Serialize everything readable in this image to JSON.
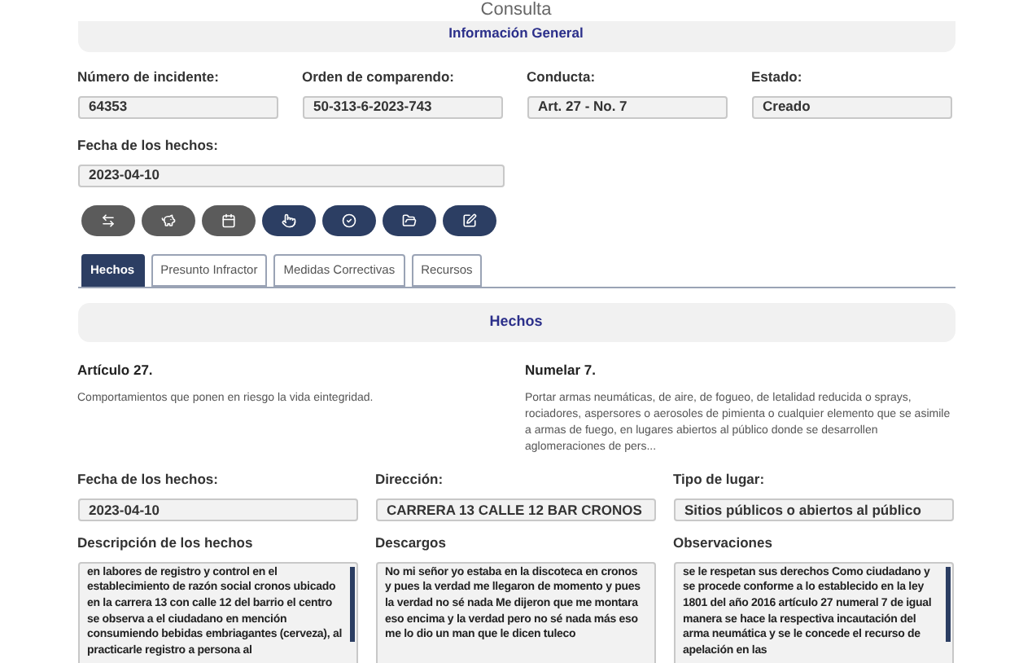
{
  "page_title": "Consulta",
  "general_header": "Información General",
  "fields": [
    {
      "label": "Número de incidente:",
      "value": "64353"
    },
    {
      "label": "Orden de comparendo:",
      "value": "50-313-6-2023-743"
    },
    {
      "label": "Conducta:",
      "value": "Art. 27 - No. 7"
    },
    {
      "label": "Estado:",
      "value": "Creado"
    }
  ],
  "date_field": {
    "label": "Fecha de los hechos:",
    "value": "2023-04-10"
  },
  "action_buttons": [
    {
      "kind": "swap"
    },
    {
      "kind": "piggy"
    },
    {
      "kind": "calendar"
    },
    {
      "kind": "hand"
    },
    {
      "kind": "check"
    },
    {
      "kind": "folder"
    },
    {
      "kind": "note"
    }
  ],
  "tabs": [
    {
      "label": "Hechos",
      "selected": true
    },
    {
      "label": "Presunto Infractor",
      "selected": false
    },
    {
      "label": "Medidas Correctivas",
      "selected": false
    },
    {
      "label": "Recursos",
      "selected": false
    }
  ],
  "section_header": "Hechos",
  "article": {
    "title": "Artículo 27.",
    "text": "Comportamientos que ponen en riesgo la vida eintegridad."
  },
  "numeral": {
    "title": "Numelar 7.",
    "text": "Portar armas neumáticas, de aire, de fogueo, de letalidad reducida o sprays, rociadores, aspersores o aerosoles de pimienta o cualquier elemento que se asimile a armas de fuego, en lugares abiertos al público donde se desarrollen aglomeraciones de pers..."
  },
  "detail_fields": [
    {
      "label": "Fecha de los hechos:",
      "value": "2023-04-10"
    },
    {
      "label": "Dirección:",
      "value": "CARRERA 13 CALLE 12 BAR CRONOS"
    },
    {
      "label": "Tipo de lugar:",
      "value": "Sitios públicos o abiertos al público"
    }
  ],
  "text_areas": [
    {
      "label": "Descripción de los hechos",
      "value": "en labores de registro y control en el establecimiento de razón social cronos ubicado en la carrera 13 con calle 12 del barrio el centro se observa a el ciudadano en mención consumiendo bebidas embriagantes (cerveza), al  practicarle registro a persona al",
      "scrollbar": true
    },
    {
      "label": "Descargos",
      "value": "No mi señor yo estaba en la discoteca en cronos y pues la verdad me llegaron de momento y pues la verdad no sé nada Me dijeron que me montara eso encima y la verdad pero no sé nada más eso me lo dio un man que le dicen tuleco",
      "scrollbar": false
    },
    {
      "label": "Observaciones",
      "value": "se le respetan sus derechos Como ciudadano y se procede conforme a lo establecido en la ley 1801 del año 2016 artículo 27 numeral 7 de igual manera se hace la respectiva incautación del arma neumática y se le concede el recurso de apelación en las",
      "scrollbar": true
    }
  ]
}
